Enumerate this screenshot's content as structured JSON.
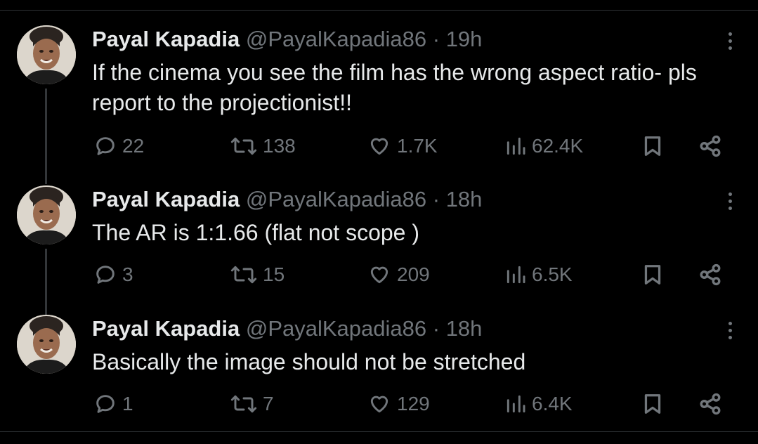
{
  "tweets": [
    {
      "author_name": "Payal Kapadia",
      "handle": "@PayalKapadia86",
      "separator": "·",
      "time": "19h",
      "text": "If the cinema you see the film has the wrong aspect ratio- pls report to the projectionist!!",
      "replies": "22",
      "retweets": "138",
      "likes": "1.7K",
      "views": "62.4K"
    },
    {
      "author_name": "Payal Kapadia",
      "handle": "@PayalKapadia86",
      "separator": "·",
      "time": "18h",
      "text": "The AR is 1:1.66 (flat not scope )",
      "replies": "3",
      "retweets": "15",
      "likes": "209",
      "views": "6.5K"
    },
    {
      "author_name": "Payal Kapadia",
      "handle": "@PayalKapadia86",
      "separator": "·",
      "time": "18h",
      "text": "Basically the image should not be stretched",
      "replies": "1",
      "retweets": "7",
      "likes": "129",
      "views": "6.4K"
    }
  ],
  "icons": {
    "reply": "reply-icon",
    "retweet": "retweet-icon",
    "like": "heart-icon",
    "views": "views-bar-chart-icon",
    "bookmark": "bookmark-icon",
    "share": "share-icon",
    "more": "more-vertical-icon"
  },
  "colors": {
    "background": "#000000",
    "primary_text": "#e7e9ea",
    "secondary_text": "#71767b",
    "thread_line": "#333639"
  }
}
